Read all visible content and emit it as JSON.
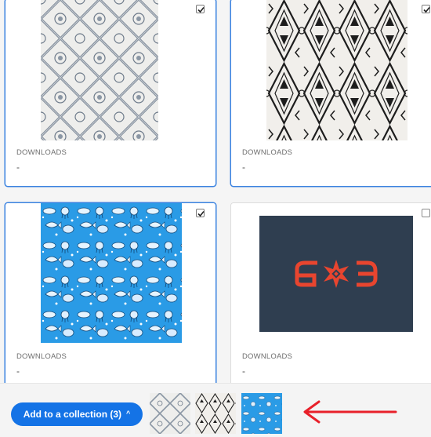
{
  "cards": [
    {
      "label": "DOWNLOADS",
      "value": "-",
      "checked": true
    },
    {
      "label": "DOWNLOADS",
      "value": "-",
      "checked": true
    },
    {
      "label": "DOWNLOADS",
      "value": "-",
      "checked": true
    },
    {
      "label": "DOWNLOADS",
      "value": "-",
      "checked": false
    }
  ],
  "thumbnails": [
    {
      "icon": "grey-damask-pattern-thumbnail"
    },
    {
      "icon": "black-white-tribal-pattern-thumbnail"
    },
    {
      "icon": "blue-sea-creatures-pattern-thumbnail"
    },
    {
      "icon": "navy-logo-thumbnail"
    }
  ],
  "collection_bar": {
    "button_label": "Add to a collection (3)",
    "chevron": "^"
  },
  "colors": {
    "accent": "#1473e6",
    "selected_border": "#3a82e0",
    "arrow": "#e8202a",
    "sea_blue": "#2a9be6",
    "navy": "#2f3e50",
    "logo_red": "#e8452f"
  }
}
